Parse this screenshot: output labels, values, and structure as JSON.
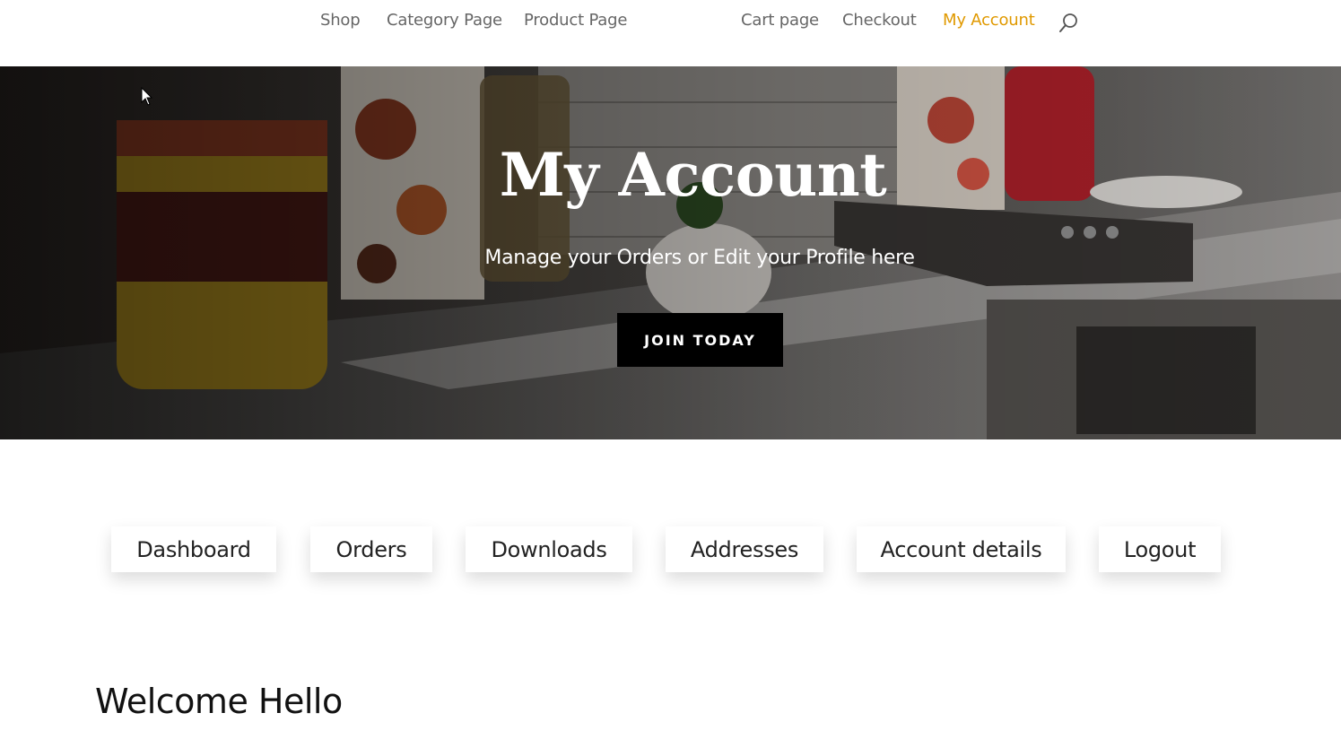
{
  "nav": {
    "items": [
      {
        "label": "Shop"
      },
      {
        "label": "Category Page"
      },
      {
        "label": "Product Page"
      },
      {
        "label": "Cart page"
      },
      {
        "label": "Checkout"
      },
      {
        "label": "My Account",
        "active": true
      }
    ],
    "search_icon": "search-icon",
    "active_color": "#e09900"
  },
  "hero": {
    "title": "My Account",
    "subtitle": "Manage your Orders or Edit your Profile here",
    "button_label": "JOIN TODAY"
  },
  "account_tabs": [
    {
      "label": "Dashboard"
    },
    {
      "label": "Orders"
    },
    {
      "label": "Downloads"
    },
    {
      "label": "Addresses"
    },
    {
      "label": "Account details"
    },
    {
      "label": "Logout"
    }
  ],
  "welcome_text": "Welcome Hello"
}
